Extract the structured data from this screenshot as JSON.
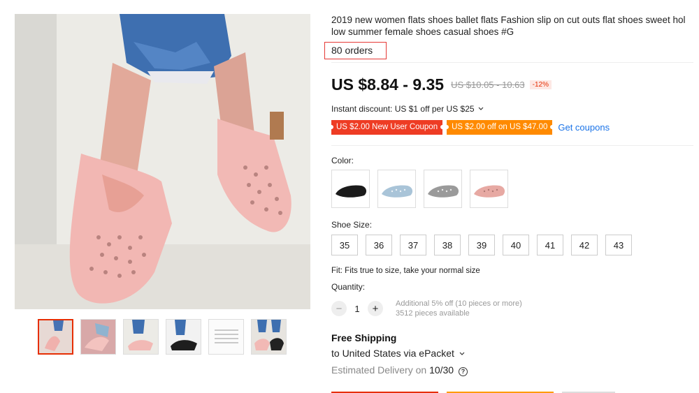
{
  "product": {
    "title": "2019 new women flats shoes ballet flats Fashion slip on cut outs flat shoes sweet hol low summer female shoes casual shoes #G",
    "orders": "80 orders"
  },
  "price": {
    "current": "US $8.84 - 9.35",
    "original": "US $10.05 - 10.63",
    "discount": "-12%"
  },
  "promo": {
    "instant_discount": "Instant discount: US $1 off per US $25",
    "coupon_new_user": "US $2.00 New User Coupon",
    "coupon_off": "US $2.00 off on US $47.00",
    "get_coupons": "Get coupons"
  },
  "color": {
    "label": "Color:",
    "options": [
      "black",
      "light-blue",
      "grey",
      "pink"
    ]
  },
  "size": {
    "label": "Shoe Size:",
    "options": [
      "35",
      "36",
      "37",
      "38",
      "39",
      "40",
      "41",
      "42",
      "43"
    ]
  },
  "fit": "Fit: Fits true to size, take your normal size",
  "quantity": {
    "label": "Quantity:",
    "minus": "−",
    "value": "1",
    "plus": "+",
    "note_1": "Additional 5% off (10 pieces or more)",
    "note_2": "3512 pieces available"
  },
  "shipping": {
    "title": "Free Shipping",
    "to": "to United States via ePacket",
    "est_prefix": "Estimated Delivery on",
    "est_date": "10/30"
  },
  "colors": {
    "accent_red": "#e62e04",
    "coupon_red": "#ee3c24",
    "coupon_orange": "#ff8a00",
    "link_blue": "#1a73e8"
  }
}
